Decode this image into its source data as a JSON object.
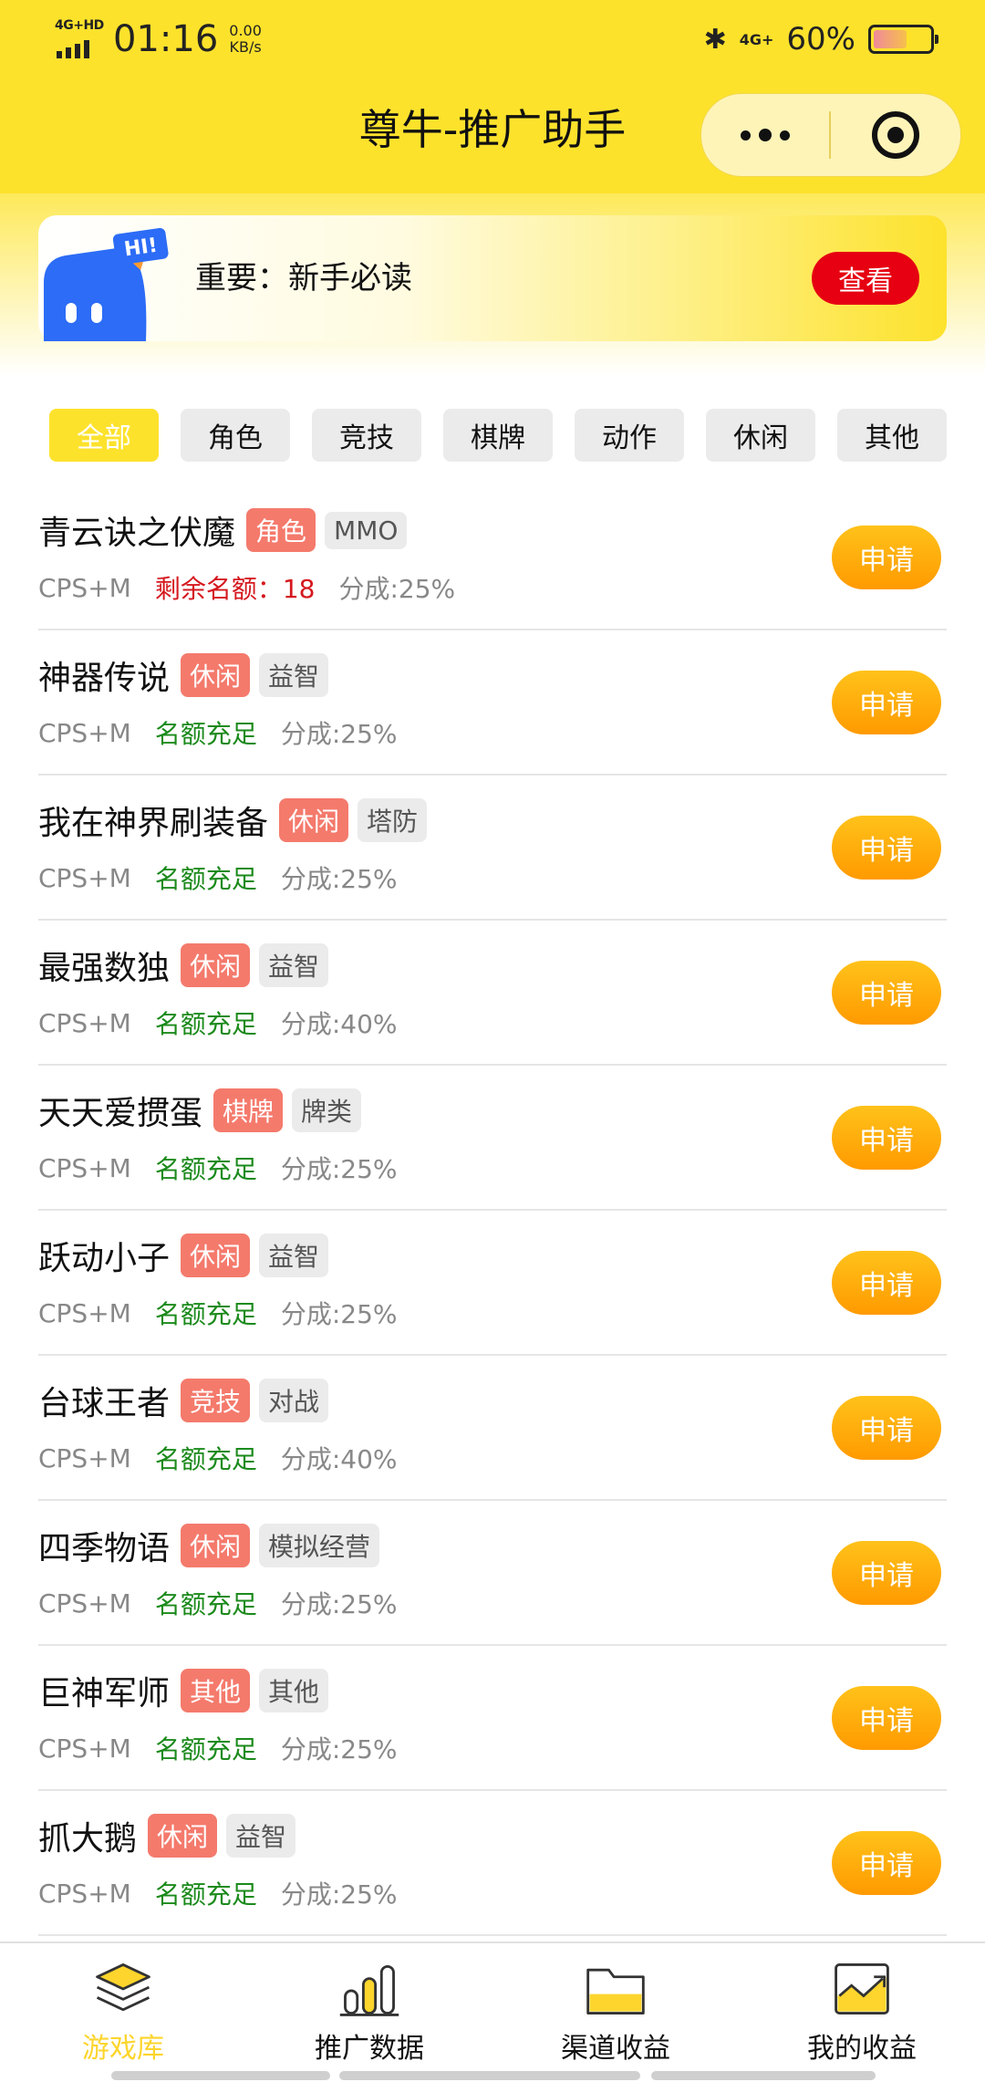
{
  "status_bar": {
    "network_left": "4G+HD",
    "time": "01:16",
    "speed_value": "0.00",
    "speed_unit": "KB/s",
    "network_right": "4G+",
    "battery_percent": "60%",
    "battery_level": 0.6
  },
  "header": {
    "title": "尊牛-推广助手",
    "capsule_icons": [
      "more-dots-icon",
      "close-target-icon"
    ]
  },
  "notice": {
    "badge": "HI!",
    "text": "重要：新手必读",
    "button_label": "查看"
  },
  "categories": [
    {
      "label": "全部",
      "active": true
    },
    {
      "label": "角色",
      "active": false
    },
    {
      "label": "竞技",
      "active": false
    },
    {
      "label": "棋牌",
      "active": false
    },
    {
      "label": "动作",
      "active": false
    },
    {
      "label": "休闲",
      "active": false
    },
    {
      "label": "其他",
      "active": false
    }
  ],
  "games": [
    {
      "name": "青云诀之伏魔",
      "tag1": "角色",
      "tag2": "MMO",
      "model": "CPS+M",
      "quota": "剩余名额：18",
      "quota_status": "low",
      "share": "分成:25%",
      "button": "申请"
    },
    {
      "name": "神器传说",
      "tag1": "休闲",
      "tag2": "益智",
      "model": "CPS+M",
      "quota": "名额充足",
      "quota_status": "ok",
      "share": "分成:25%",
      "button": "申请"
    },
    {
      "name": "我在神界刷装备",
      "tag1": "休闲",
      "tag2": "塔防",
      "model": "CPS+M",
      "quota": "名额充足",
      "quota_status": "ok",
      "share": "分成:25%",
      "button": "申请"
    },
    {
      "name": "最强数独",
      "tag1": "休闲",
      "tag2": "益智",
      "model": "CPS+M",
      "quota": "名额充足",
      "quota_status": "ok",
      "share": "分成:40%",
      "button": "申请"
    },
    {
      "name": "天天爱掼蛋",
      "tag1": "棋牌",
      "tag2": "牌类",
      "model": "CPS+M",
      "quota": "名额充足",
      "quota_status": "ok",
      "share": "分成:25%",
      "button": "申请"
    },
    {
      "name": "跃动小子",
      "tag1": "休闲",
      "tag2": "益智",
      "model": "CPS+M",
      "quota": "名额充足",
      "quota_status": "ok",
      "share": "分成:25%",
      "button": "申请"
    },
    {
      "name": "台球王者",
      "tag1": "竞技",
      "tag2": "对战",
      "model": "CPS+M",
      "quota": "名额充足",
      "quota_status": "ok",
      "share": "分成:40%",
      "button": "申请"
    },
    {
      "name": "四季物语",
      "tag1": "休闲",
      "tag2": "模拟经营",
      "model": "CPS+M",
      "quota": "名额充足",
      "quota_status": "ok",
      "share": "分成:25%",
      "button": "申请"
    },
    {
      "name": "巨神军师",
      "tag1": "其他",
      "tag2": "其他",
      "model": "CPS+M",
      "quota": "名额充足",
      "quota_status": "ok",
      "share": "分成:25%",
      "button": "申请"
    },
    {
      "name": "抓大鹅",
      "tag1": "休闲",
      "tag2": "益智",
      "model": "CPS+M",
      "quota": "名额充足",
      "quota_status": "ok",
      "share": "分成:25%",
      "button": "申请"
    }
  ],
  "tabbar": [
    {
      "label": "游戏库",
      "icon": "layers-icon",
      "active": true
    },
    {
      "label": "推广数据",
      "icon": "bar-chart-icon",
      "active": false
    },
    {
      "label": "渠道收益",
      "icon": "folder-icon",
      "active": false
    },
    {
      "label": "我的收益",
      "icon": "trend-image-icon",
      "active": false
    }
  ],
  "colors": {
    "brand_yellow": "#FDE22C",
    "apply_orange": "#FFA800",
    "tag_red": "#F47A6C",
    "quota_ok": "#1B8A1B",
    "quota_low": "#D5181E",
    "notice_button": "#E60012"
  }
}
